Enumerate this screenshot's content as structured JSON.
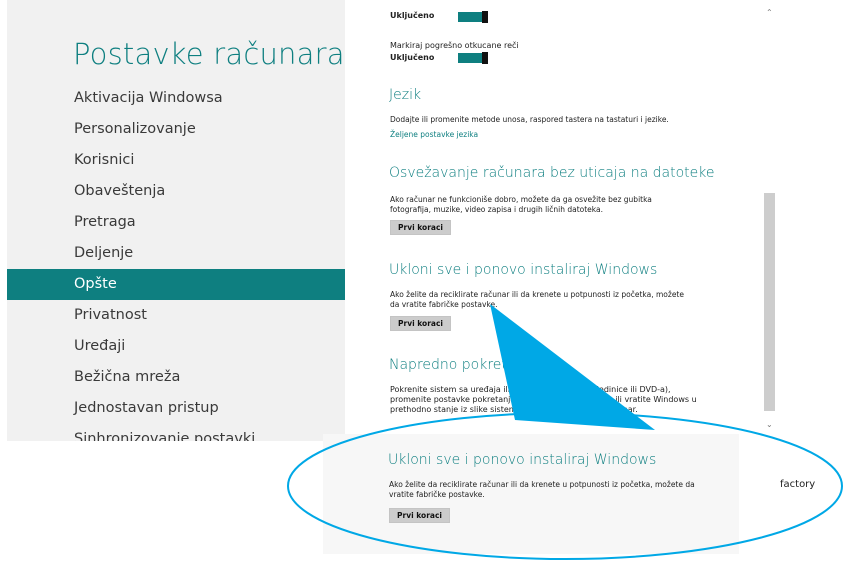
{
  "app_title": "Postavke računara",
  "nav_items": [
    "Aktivacija Windowsa",
    "Personalizovanje",
    "Korisnici",
    "Obaveštenja",
    "Pretraga",
    "Deljenje",
    "Opšte",
    "Privatnost",
    "Uređaji",
    "Bežična mreža",
    "Jednostavan pristup",
    "Sinhronizovanje postavki"
  ],
  "selected_nav": "Opšte",
  "settings": {
    "toggle1_state": "Uključeno",
    "toggle2_label": "Markiraj pogrešno otkucane reči",
    "toggle2_state": "Uključeno",
    "language": {
      "heading": "Jezik",
      "description": "Dodajte ili promenite metode unosa, raspored tastera na tastaturi i jezike.",
      "link": "Željene postavke jezika"
    },
    "refresh": {
      "heading": "Osvežavanje računara bez uticaja na datoteke",
      "description": "Ako računar ne funkcioniše dobro, možete da ga osvežite bez gubitka fotografija, muzike, video zapisa i drugih ličnih datoteka.",
      "button": "Prvi koraci"
    },
    "reinstall": {
      "heading": "Ukloni sve i ponovo instaliraj Windows",
      "description": "Ako želite da reciklirate računar ili da krenete u potpunosti iz početka, možete da vratite fabričke postavke.",
      "button": "Prvi koraci"
    },
    "advanced": {
      "heading": "Napredno pokreta",
      "line1_left": "Pokrenite sistem sa uređaja ili dis",
      "line1_right": "B disk jedinice ili DVD-a),",
      "line2_left": "promenite postavke pokretanja o",
      "line2_right": "dows ili vratite Windows u",
      "line3_left": "prethodno stanje iz slike sistema.",
      "line3_right": "računar."
    }
  },
  "callout": {
    "heading": "Ukloni sve i ponovo instaliraj Windows",
    "description": "Ako želite da reciklirate računar ili da krenete u potpunosti iz početka, možete da vratite fabričke postavke.",
    "button": "Prvi koraci",
    "side_label": "factory"
  },
  "colors": {
    "accent": "#0e7f80",
    "callout_blue": "#00a8e6",
    "left_pane_bg": "#f1f1f1"
  },
  "icons": {
    "scroll_up": "chevron-up-icon",
    "scroll_down": "chevron-down-icon"
  }
}
